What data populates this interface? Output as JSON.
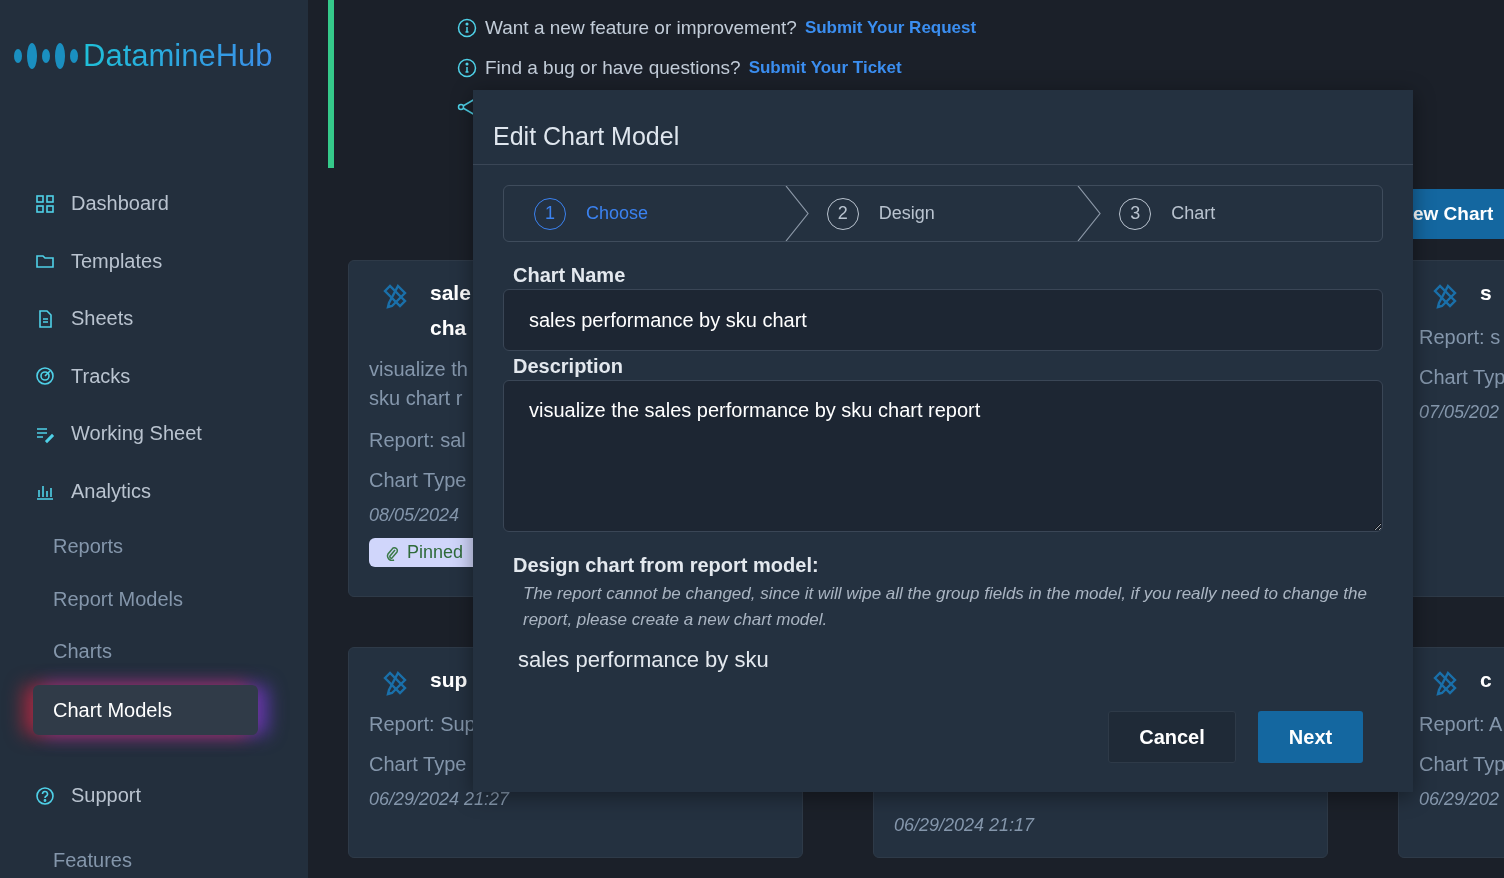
{
  "sidebar": {
    "logo": "DatamineHub",
    "items": [
      {
        "label": "Dashboard",
        "kind": "main",
        "selected": false
      },
      {
        "label": "Templates",
        "kind": "main",
        "selected": false
      },
      {
        "label": "Sheets",
        "kind": "main",
        "selected": false
      },
      {
        "label": "Tracks",
        "kind": "main",
        "selected": false
      },
      {
        "label": "Working Sheet",
        "kind": "main",
        "selected": false
      },
      {
        "label": "Analytics",
        "kind": "main",
        "selected": false
      },
      {
        "label": "Reports",
        "kind": "sub",
        "selected": false
      },
      {
        "label": "Report Models",
        "kind": "sub",
        "selected": false
      },
      {
        "label": "Charts",
        "kind": "sub",
        "selected": false
      },
      {
        "label": "Chart Models",
        "kind": "sub",
        "selected": true
      },
      {
        "label": "Support",
        "kind": "main",
        "selected": false
      },
      {
        "label": "Features",
        "kind": "sub",
        "selected": false
      }
    ]
  },
  "notices": [
    {
      "text": "Want a new feature or improvement?",
      "link": "Submit Your Request"
    },
    {
      "text": "Find a bug or have questions?",
      "link": "Submit Your Ticket"
    }
  ],
  "new_chart_button": "ew Chart",
  "cards": [
    {
      "title": [
        "sale",
        "cha"
      ],
      "lines": [
        "visualize th",
        "sku chart r"
      ],
      "report": "Report: sal",
      "chart_type": "Chart Type",
      "date": "08/05/2024",
      "badge": "Pinned"
    },
    {
      "title": [
        "s"
      ],
      "report": "Report: s",
      "chart_type": "Chart Typ",
      "date": "07/05/202"
    },
    {
      "title": [
        "sup"
      ],
      "report": "Report: Sup",
      "chart_type": "Chart Type",
      "date": "06/29/2024 21:27"
    },
    {
      "date": "06/29/2024 21:17"
    },
    {
      "title": [
        "c"
      ],
      "report": "Report: A",
      "chart_type": "Chart Typ",
      "date": "06/29/202"
    }
  ],
  "modal": {
    "title": "Edit Chart Model",
    "steps": [
      {
        "number": "1",
        "label": "Choose",
        "selected": true
      },
      {
        "number": "2",
        "label": "Design",
        "selected": false
      },
      {
        "number": "3",
        "label": "Chart",
        "selected": false
      }
    ],
    "name_label": "Chart Name",
    "name_value": "sales performance by sku chart",
    "description_label": "Description",
    "description_value": "visualize the sales performance by sku chart report",
    "report_label": "Design chart from report model:",
    "report_note": "The report cannot be changed, since it will wipe all the group fields in the model, if you really need to change the report, please create a new chart model.",
    "report_name": "sales performance by sku",
    "buttons": [
      {
        "label": "Cancel",
        "kind": "secondary"
      },
      {
        "label": "Next",
        "kind": "primary"
      }
    ]
  }
}
